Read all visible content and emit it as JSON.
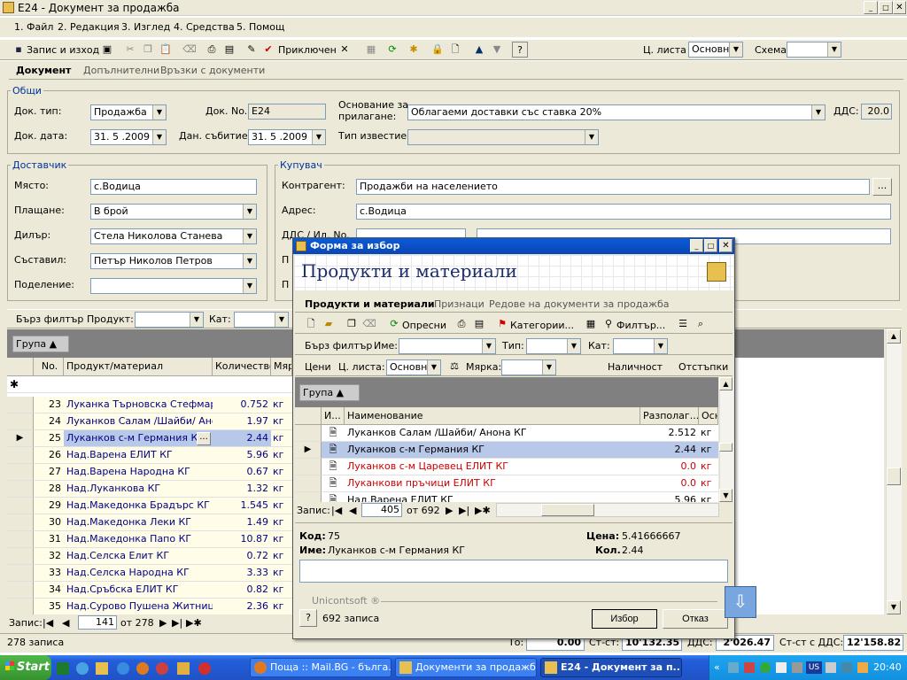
{
  "window": {
    "title": "E24 - Документ за продажба"
  },
  "menu": [
    "1. Файл",
    "2. Редакция",
    "3. Изглед",
    "4. Средства",
    "5. Помощ"
  ],
  "toolbar": {
    "save_exit": "Запис и изход",
    "accept": "Приключен",
    "price_list_label": "Ц. листа",
    "price_list_value": "Основна",
    "scheme_label": "Схема",
    "scheme_value": ""
  },
  "tabs": {
    "doc": "Документ",
    "extra": "Допълнителни",
    "links": "Връзки с документи"
  },
  "general": {
    "title": "Общи",
    "doc_type_label": "Док. тип:",
    "doc_type_value": "Продажба",
    "doc_no_label": "Док. No.",
    "doc_no_value": "E24",
    "basis_label_1": "Основание за",
    "basis_label_2": "прилагане:",
    "basis_value": "Облагаеми доставки със ставка 20%",
    "vat_label": "ДДС:",
    "vat_value": "20.0",
    "doc_date_label": "Док. дата:",
    "doc_date_value": "31. 5 .2009",
    "tax_event_label": "Дан. събитие:",
    "tax_event_value": "31. 5 .2009",
    "notice_type_label": "Тип известие:",
    "notice_type_value": ""
  },
  "supplier": {
    "title": "Доставчик",
    "place_label": "Място:",
    "place_value": "с.Водица",
    "payment_label": "Плащане:",
    "payment_value": "В брой",
    "dealer_label": "Дилър:",
    "dealer_value": "Стела Николова Станева",
    "author_label": "Съставил:",
    "author_value": "Петър Николов Петров",
    "division_label": "Поделение:",
    "division_value": ""
  },
  "buyer": {
    "title": "Купувач",
    "partner_label": "Контрагент:",
    "partner_value": "Продажби на населението",
    "address_label": "Адрес:",
    "address_value": "с.Водица",
    "vat_id_label": "ДДС / Ид. No.",
    "p1": "П",
    "p2": "П"
  },
  "filter": {
    "quick": "Бърз филтър",
    "product_label": "Продукт:",
    "cat_label": "Кат:"
  },
  "grid": {
    "group_label": "Група",
    "headers": {
      "no": "No.",
      "product": "Продукт/материал",
      "qty": "Количество",
      "unit": "Мяр"
    },
    "rows": [
      {
        "no": "23",
        "name": "Луканка Търновска Стефмар...",
        "qty": "0.752",
        "unit": "кг"
      },
      {
        "no": "24",
        "name": "Луканков Салам /Шайби/ Ано...",
        "qty": "1.97",
        "unit": "кг"
      },
      {
        "no": "25",
        "name": "Луканков с-м Германия КГ",
        "qty": "2.44",
        "unit": "кг"
      },
      {
        "no": "26",
        "name": "Над.Варена ЕЛИТ КГ",
        "qty": "5.96",
        "unit": "кг"
      },
      {
        "no": "27",
        "name": "Над.Варена Народна КГ",
        "qty": "0.67",
        "unit": "кг"
      },
      {
        "no": "28",
        "name": "Над.Луканкова КГ",
        "qty": "1.32",
        "unit": "кг"
      },
      {
        "no": "29",
        "name": "Над.Македонка Брадърс КГ",
        "qty": "1.545",
        "unit": "кг"
      },
      {
        "no": "30",
        "name": "Над.Македонка Леки КГ",
        "qty": "1.49",
        "unit": "кг"
      },
      {
        "no": "31",
        "name": "Над.Македонка Папо КГ",
        "qty": "10.87",
        "unit": "кг"
      },
      {
        "no": "32",
        "name": "Над.Селска Елит КГ",
        "qty": "0.72",
        "unit": "кг"
      },
      {
        "no": "33",
        "name": "Над.Селска Народна КГ",
        "qty": "3.33",
        "unit": "кг"
      },
      {
        "no": "34",
        "name": "Над.Сръбска ЕЛИТ КГ",
        "qty": "0.82",
        "unit": "кг"
      },
      {
        "no": "35",
        "name": "Над.Сурово Пушена Житниц...",
        "qty": "2.36",
        "unit": "кг"
      }
    ],
    "nav_label": "Запис:",
    "nav_current": "141",
    "nav_total": "от 278"
  },
  "status": {
    "records": "278 записа"
  },
  "totals": {
    "to_label": "То:",
    "to_value": "0.00",
    "st_label": "Ст-ст:",
    "st_value": "10'132.35",
    "vat_label": "ДДС:",
    "vat_value": "2'026.47",
    "total_label": "Ст-ст с ДДС:",
    "total_value": "12'158.82"
  },
  "dialog": {
    "title": "Форма за избор",
    "heading": "Продукти и материали",
    "tabs": {
      "products": "Продукти и материали",
      "signs": "Признаци",
      "rows": "Редове на документи за продажба"
    },
    "toolbar": {
      "refresh": "Опресни",
      "categories": "Категории...",
      "filters": "Филтър..."
    },
    "filter": {
      "quick": "Бърз филтър",
      "name_label": "Име:",
      "type_label": "Тип:",
      "cat_label": "Кат:"
    },
    "filter2": {
      "prices": "Цени",
      "price_list_label": "Ц. листа:",
      "price_list_value": "Основна",
      "unit_label": "Мярка:",
      "availability": "Наличност",
      "discounts": "Отстъпки"
    },
    "group_label": "Група",
    "headers": {
      "id": "И...",
      "name": "Наименование",
      "available": "Разполаг...",
      "unit": "Осн."
    },
    "rows": [
      {
        "name": "Луканков Салам /Шайби/ Анона КГ",
        "avail": "2.512",
        "unit": "кг",
        "red": false
      },
      {
        "name": "Луканков с-м Германия КГ",
        "avail": "2.44",
        "unit": "кг",
        "red": false
      },
      {
        "name": "Луканков с-м Царевец ЕЛИТ КГ",
        "avail": "0.0",
        "unit": "кг",
        "red": true
      },
      {
        "name": "Луканкови пръчици ЕЛИТ КГ",
        "avail": "0.0",
        "unit": "кг",
        "red": true
      },
      {
        "name": "Над.Варена ЕЛИТ КГ",
        "avail": "5.96",
        "unit": "кг",
        "red": false
      }
    ],
    "nav_label": "Запис:",
    "nav_current": "405",
    "nav_total": "от 692",
    "detail": {
      "code_label": "Код:",
      "code_value": "75",
      "name_label": "Име:",
      "name_value": "Луканков с-м Германия КГ",
      "price_label": "Цена:",
      "price_value": "5.41666667",
      "qty_label": "Кол.",
      "qty_value": "2.44"
    },
    "brand": "Unicontsoft ®",
    "records": "692 записа",
    "select_btn": "Избор",
    "cancel_btn": "Отказ"
  },
  "taskbar": {
    "start": "Start",
    "tasks": [
      "Поща :: Mail.BG - бълга...",
      "Документи за продажб...",
      "E24 - Документ за п..."
    ],
    "lang": "US",
    "clock": "20:40"
  }
}
